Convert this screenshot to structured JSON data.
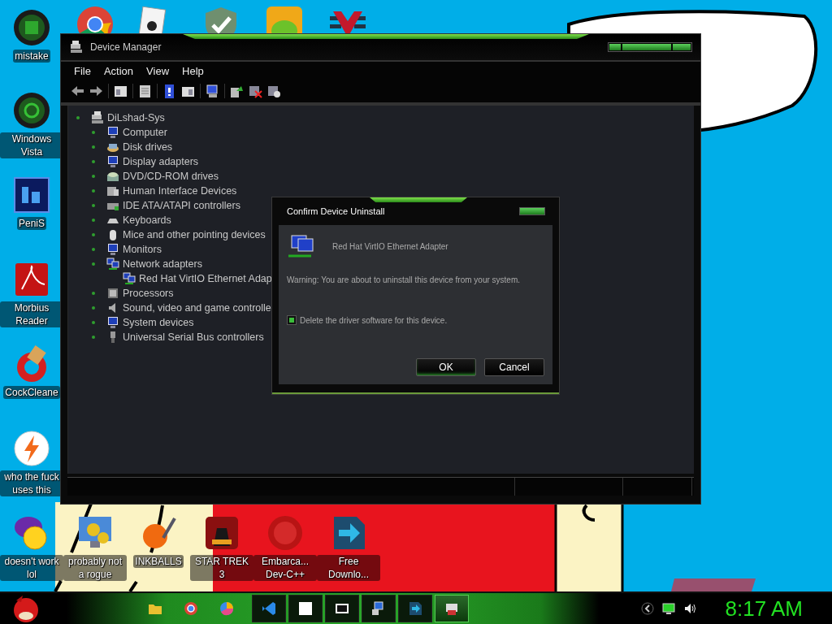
{
  "desktop_icons": [
    {
      "label": "mistake"
    },
    {
      "label": "Windows Vista"
    },
    {
      "label": "PeniS"
    },
    {
      "label": "Morbius Reader"
    },
    {
      "label": "CockCleane"
    },
    {
      "label": "who the fuck uses this"
    },
    {
      "label": "doesn't work lol"
    },
    {
      "label": "probably not a rogue"
    },
    {
      "label": "INKBALLS"
    },
    {
      "label": "STAR TREK 3"
    },
    {
      "label": "Embarca... Dev-C++"
    },
    {
      "label": "Free Downlo..."
    }
  ],
  "window": {
    "title": "Device Manager",
    "menu": [
      "File",
      "Action",
      "View",
      "Help"
    ],
    "tree": {
      "label": "DiLshad-Sys",
      "children": [
        {
          "label": "Computer"
        },
        {
          "label": "Disk drives"
        },
        {
          "label": "Display adapters"
        },
        {
          "label": "DVD/CD-ROM drives"
        },
        {
          "label": "Human Interface Devices"
        },
        {
          "label": "IDE ATA/ATAPI controllers"
        },
        {
          "label": "Keyboards"
        },
        {
          "label": "Mice and other pointing devices"
        },
        {
          "label": "Monitors"
        },
        {
          "label": "Network adapters",
          "children": [
            {
              "label": "Red Hat VirtIO Ethernet Adap"
            }
          ]
        },
        {
          "label": "Processors"
        },
        {
          "label": "Sound, video and game controlle"
        },
        {
          "label": "System devices"
        },
        {
          "label": "Universal Serial Bus controllers"
        }
      ]
    }
  },
  "dialog": {
    "title": "Confirm Device Uninstall",
    "device": "Red Hat VirtIO Ethernet Adapter",
    "warning": "Warning: You are about to uninstall this device from your system.",
    "delete_driver": {
      "label": "Delete the driver software for this device.",
      "checked": true
    },
    "buttons": [
      "OK",
      "Cancel"
    ]
  },
  "taskbar": {
    "tasks": [
      {
        "selected": false
      },
      {
        "selected": false
      },
      {
        "selected": false
      },
      {
        "selected": false
      },
      {
        "selected": false
      },
      {
        "selected": true
      }
    ],
    "clock": "8:17 AM"
  }
}
